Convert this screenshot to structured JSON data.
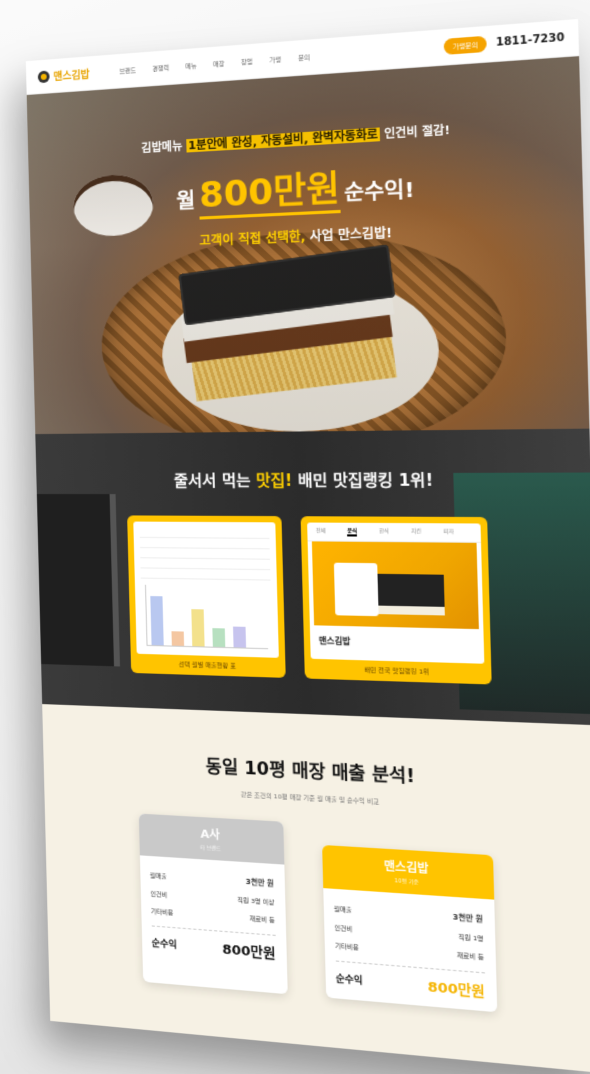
{
  "nav": {
    "brand": "맨스김밥",
    "menu": [
      "브랜드",
      "경쟁력",
      "메뉴",
      "매장",
      "창업",
      "가맹",
      "문의"
    ],
    "cta": "가맹문의",
    "phone": "1811-7230"
  },
  "hero": {
    "line1_pre": "김밥메뉴 ",
    "line1_hl": "1분안에 완성, 자동설비, 완벽자동화로",
    "line1_post": " 인건비 절감!",
    "line2_pre": "월",
    "line2_num": "800만원",
    "line2_post": "순수익!",
    "line3_yel": "고객이 직접 선택한,",
    "line3_post": " 사업 만스김밥!"
  },
  "ranking": {
    "title_pre": "줄서서 먹는 ",
    "title_yel": "맛집!",
    "title_post": " 배민 맛집랭킹 1위!",
    "left_caption": "선택 월별 매출현황 표",
    "right_tabs": [
      "전체",
      "분식",
      "한식",
      "치킨",
      "피자"
    ],
    "right_name": "맨스김밥",
    "right_caption": "배민 전국 맛집랭킹 1위"
  },
  "analysis": {
    "title": "동일 10평 매장 매출 분석!",
    "subtitle": "같은 조건의 10평 매장 기준 월 매출 및 순수익 비교",
    "left": {
      "name": "A사",
      "sub": "타 브랜드",
      "rows": [
        {
          "label": "월매출",
          "value": "3천만 원"
        },
        {
          "label": "인건비",
          "value": "직원 3명 이상"
        },
        {
          "label": "기타비용",
          "value": "재료비 등"
        }
      ],
      "profit_label": "순수익",
      "profit_value": "800만원"
    },
    "right": {
      "name": "맨스김밥",
      "sub": "10평 기준",
      "rows": [
        {
          "label": "월매출",
          "value": "3천만 원"
        },
        {
          "label": "인건비",
          "value": "직원 1명"
        },
        {
          "label": "기타비용",
          "value": "재료비 등"
        }
      ],
      "profit_label": "순수익",
      "profit_value": "800만원"
    }
  },
  "colors": {
    "accent": "#ffc400",
    "cta": "#f5a300"
  }
}
